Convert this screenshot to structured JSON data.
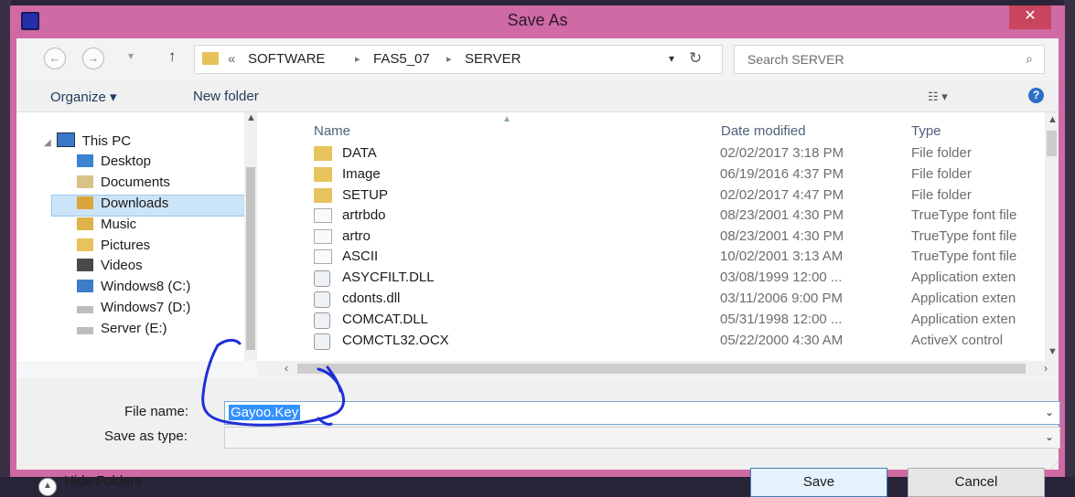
{
  "window": {
    "title": "Save As",
    "close_glyph": "✕"
  },
  "nav": {
    "back_glyph": "←",
    "forward_glyph": "→",
    "recent_glyph": "▾",
    "up_glyph": "↑",
    "path_prefix": "«",
    "breadcrumb": [
      "SOFTWARE",
      "FAS5_07",
      "SERVER"
    ],
    "breadcrumb_sep": "▸",
    "address_dropdown_glyph": "▾",
    "refresh_glyph": "↻",
    "search_placeholder": "Search SERVER",
    "search_glyph": "⌕"
  },
  "toolbar": {
    "organize_label": "Organize ▾",
    "new_folder_label": "New folder",
    "views_glyph": "☷ ▾",
    "help_glyph": "?"
  },
  "sidebar": {
    "items": [
      {
        "label": "This PC",
        "icon": "pc-icon"
      },
      {
        "label": "Desktop",
        "icon": "desktop-icon"
      },
      {
        "label": "Documents",
        "icon": "documents-icon"
      },
      {
        "label": "Downloads",
        "icon": "downloads-icon",
        "selected": true
      },
      {
        "label": "Music",
        "icon": "music-icon"
      },
      {
        "label": "Pictures",
        "icon": "pictures-icon"
      },
      {
        "label": "Videos",
        "icon": "videos-icon"
      },
      {
        "label": "Windows8 (C:)",
        "icon": "drive-icon"
      },
      {
        "label": "Windows7 (D:)",
        "icon": "drive-icon"
      },
      {
        "label": "Server (E:)",
        "icon": "drive-icon"
      }
    ]
  },
  "files": {
    "columns": {
      "name": "Name",
      "date": "Date modified",
      "type": "Type"
    },
    "rows": [
      {
        "name": "DATA",
        "date": "02/02/2017 3:18 PM",
        "type": "File folder",
        "kind": "folder"
      },
      {
        "name": "Image",
        "date": "06/19/2016 4:37 PM",
        "type": "File folder",
        "kind": "folder"
      },
      {
        "name": "SETUP",
        "date": "02/02/2017 4:47 PM",
        "type": "File folder",
        "kind": "folder"
      },
      {
        "name": "artrbdo",
        "date": "08/23/2001 4:30 PM",
        "type": "TrueType font file",
        "kind": "font"
      },
      {
        "name": "artro",
        "date": "08/23/2001 4:30 PM",
        "type": "TrueType font file",
        "kind": "font"
      },
      {
        "name": "ASCII",
        "date": "10/02/2001 3:13 AM",
        "type": "TrueType font file",
        "kind": "font"
      },
      {
        "name": "ASYCFILT.DLL",
        "date": "03/08/1999 12:00 ...",
        "type": "Application exten",
        "kind": "dll"
      },
      {
        "name": "cdonts.dll",
        "date": "03/11/2006 9:00 PM",
        "type": "Application exten",
        "kind": "dll"
      },
      {
        "name": "COMCAT.DLL",
        "date": "05/31/1998 12:00 ...",
        "type": "Application exten",
        "kind": "dll"
      },
      {
        "name": "COMCTL32.OCX",
        "date": "05/22/2000 4:30 AM",
        "type": "ActiveX control",
        "kind": "dll"
      }
    ]
  },
  "form": {
    "file_name_label": "File name:",
    "file_name_value": "Gayoo.Key",
    "save_as_type_label": "Save as type:",
    "save_as_type_value": "",
    "dropdown_glyph": "⌄"
  },
  "footer": {
    "hide_folders_label": "Hide Folders",
    "save_label": "Save",
    "cancel_label": "Cancel"
  },
  "colors": {
    "window_frame": "#cf6aa4",
    "close_button": "#c8455d",
    "selection": "#3390ff",
    "annotation_ink": "#1f2fd6"
  }
}
